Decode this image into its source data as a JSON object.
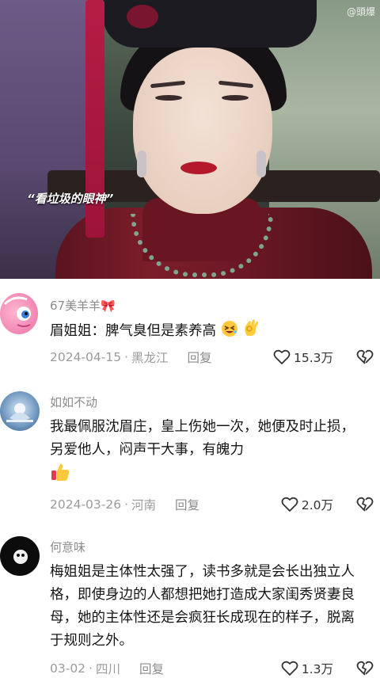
{
  "video": {
    "caption": "“看垃圾的眼神”",
    "watermark": "@頭爆"
  },
  "comments": [
    {
      "username": "67美羊羊🎀",
      "text": "眉姐姐：脾气臭但是素养高",
      "date": "2024-04-15",
      "location": "黑龙江",
      "reply_label": "回复",
      "likes": "15.3万",
      "emoji": [
        "laughing-wink-emoji",
        "ok-hand-emoji"
      ]
    },
    {
      "username": "如如不动",
      "text": "我最佩服沈眉庄，皇上伤她一次，她便及时止损，另爱他人，闷声干大事，有魄力",
      "date": "2024-03-26",
      "location": "河南",
      "reply_label": "回复",
      "likes": "2.0万",
      "emoji": [
        "thumbs-up-emoji"
      ]
    },
    {
      "username": "何意味",
      "text": "梅姐姐是主体性太强了，读书多就是会长出独立人格，即使身边的人都想把她打造成大家闺秀贤妻良母，她的主体性还是会疯狂长成现在的样子，脱离于规则之外。",
      "date": "03-02",
      "location": "四川",
      "reply_label": "回复",
      "likes": "1.3万",
      "emoji": []
    }
  ],
  "colors": {
    "meta_gray": "#9b9b9b",
    "text": "#161616"
  }
}
